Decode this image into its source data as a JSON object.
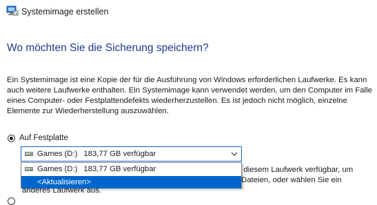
{
  "window": {
    "title": "Systemimage erstellen",
    "icon": "system-image-backup-icon"
  },
  "main": {
    "heading": "Wo möchten Sie die Sicherung speichern?",
    "description": "Ein Systemimage ist eine Kopie der für die Ausführung von Windows erforderlichen Laufwerke. Es kann auch weitere Laufwerke enthalten. Ein Systemimage kann verwendet werden, um den Computer im Falle eines Computer- oder Festplattendefekts wiederherzustellen. Es ist jedoch nicht möglich, einzelne Elemente zur Wiederherstellung auszuwählen."
  },
  "destination": {
    "option_harddisk_label": "Auf Festplatte",
    "selected": {
      "name": "Games (D:)",
      "free": "183,77 GB verfügbar"
    },
    "dropdown_options": [
      {
        "name": "Games (D:)",
        "free": "183,77 GB verfügbar"
      },
      {
        "label": "<Aktualisieren>"
      }
    ],
    "hidden_text_lines": [
      "f diesem Laufwerk verfügbar, um",
      "Dateien, oder wählen Sie ein",
      "anderes Laufwerk aus."
    ]
  },
  "colors": {
    "heading": "#1e3a8a",
    "selection": "#0066cc",
    "combo_border": "#0a64c8"
  }
}
